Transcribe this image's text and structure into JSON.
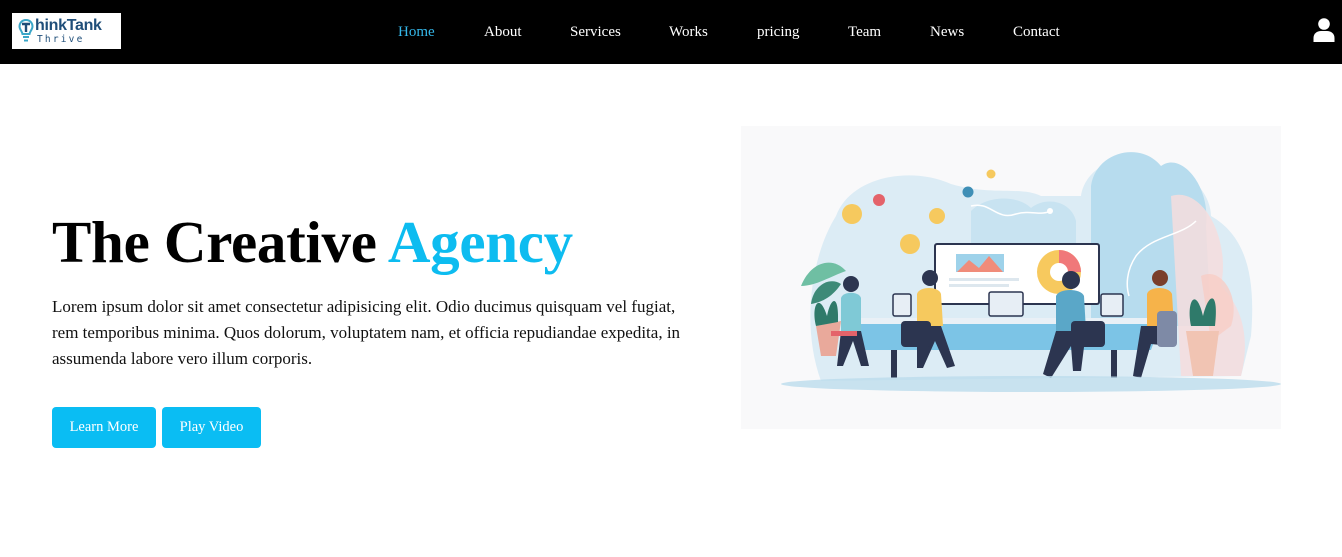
{
  "brand": {
    "name_top": "hinkTank",
    "name_bottom": "Thrive",
    "logo_initial": "T"
  },
  "nav": {
    "items": [
      {
        "label": "Home",
        "active": true
      },
      {
        "label": "About"
      },
      {
        "label": "Services"
      },
      {
        "label": "Works"
      },
      {
        "label": "pricing"
      },
      {
        "label": "Team"
      },
      {
        "label": "News"
      },
      {
        "label": "Contact"
      }
    ]
  },
  "hero": {
    "title_main": "The Creative",
    "title_accent": "Agency",
    "description": "Lorem ipsum dolor sit amet consectetur adipisicing elit. Odio ducimus quisquam vel fugiat, rem temporibus minima. Quos dolorum, voluptatem nam, et officia repudiandae expedita, in assumenda labore vero illum corporis.",
    "learn_more": "Learn More",
    "play_video": "Play Video"
  },
  "colors": {
    "accent": "#0dbcf0",
    "nav_bg": "#000000",
    "nav_active": "#35b8ea",
    "button": "#0abdf3"
  },
  "icons": {
    "account": "user-icon",
    "logo": "lightbulb-icon"
  }
}
